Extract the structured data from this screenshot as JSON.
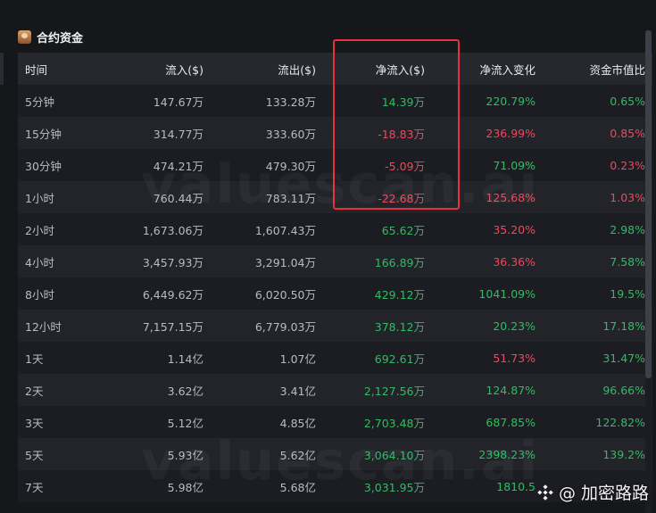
{
  "header": {
    "title": "合约资金"
  },
  "table": {
    "columns": [
      "时间",
      "流入($)",
      "流出($)",
      "净流入($)",
      "净流入变化",
      "资金市值比"
    ],
    "rows": [
      {
        "time": "5分钟",
        "inflow": "147.67万",
        "outflow": "133.28万",
        "net": "14.39万",
        "net_sign": "pos",
        "change": "220.79%",
        "change_sign": "pos",
        "ratio": "0.65%",
        "ratio_sign": "pos"
      },
      {
        "time": "15分钟",
        "inflow": "314.77万",
        "outflow": "333.60万",
        "net": "-18.83万",
        "net_sign": "neg",
        "change": "236.99%",
        "change_sign": "neg",
        "ratio": "0.85%",
        "ratio_sign": "neg"
      },
      {
        "time": "30分钟",
        "inflow": "474.21万",
        "outflow": "479.30万",
        "net": "-5.09万",
        "net_sign": "neg",
        "change": "71.09%",
        "change_sign": "pos",
        "ratio": "0.23%",
        "ratio_sign": "neg"
      },
      {
        "time": "1小时",
        "inflow": "760.44万",
        "outflow": "783.11万",
        "net": "-22.68万",
        "net_sign": "neg",
        "change": "125.68%",
        "change_sign": "neg",
        "ratio": "1.03%",
        "ratio_sign": "neg"
      },
      {
        "time": "2小时",
        "inflow": "1,673.06万",
        "outflow": "1,607.43万",
        "net": "65.62万",
        "net_sign": "pos",
        "change": "35.20%",
        "change_sign": "neg",
        "ratio": "2.98%",
        "ratio_sign": "pos"
      },
      {
        "time": "4小时",
        "inflow": "3,457.93万",
        "outflow": "3,291.04万",
        "net": "166.89万",
        "net_sign": "pos",
        "change": "36.36%",
        "change_sign": "neg",
        "ratio": "7.58%",
        "ratio_sign": "pos"
      },
      {
        "time": "8小时",
        "inflow": "6,449.62万",
        "outflow": "6,020.50万",
        "net": "429.12万",
        "net_sign": "pos",
        "change": "1041.09%",
        "change_sign": "pos",
        "ratio": "19.5%",
        "ratio_sign": "pos"
      },
      {
        "time": "12小时",
        "inflow": "7,157.15万",
        "outflow": "6,779.03万",
        "net": "378.12万",
        "net_sign": "pos",
        "change": "20.23%",
        "change_sign": "pos",
        "ratio": "17.18%",
        "ratio_sign": "pos"
      },
      {
        "time": "1天",
        "inflow": "1.14亿",
        "outflow": "1.07亿",
        "net": "692.61万",
        "net_sign": "pos",
        "change": "51.73%",
        "change_sign": "neg",
        "ratio": "31.47%",
        "ratio_sign": "pos"
      },
      {
        "time": "2天",
        "inflow": "3.62亿",
        "outflow": "3.41亿",
        "net": "2,127.56万",
        "net_sign": "pos",
        "change": "124.87%",
        "change_sign": "pos",
        "ratio": "96.66%",
        "ratio_sign": "pos"
      },
      {
        "time": "3天",
        "inflow": "5.12亿",
        "outflow": "4.85亿",
        "net": "2,703.48万",
        "net_sign": "pos",
        "change": "687.85%",
        "change_sign": "pos",
        "ratio": "122.82%",
        "ratio_sign": "pos"
      },
      {
        "time": "5天",
        "inflow": "5.93亿",
        "outflow": "5.62亿",
        "net": "3,064.10万",
        "net_sign": "pos",
        "change": "2398.23%",
        "change_sign": "pos",
        "ratio": "139.2%",
        "ratio_sign": "pos"
      },
      {
        "time": "7天",
        "inflow": "5.98亿",
        "outflow": "5.68亿",
        "net": "3,031.95万",
        "net_sign": "pos",
        "change": "1810.5",
        "change_sign": "pos",
        "ratio": "",
        "ratio_sign": "pos"
      }
    ]
  },
  "watermark": {
    "text": "valuescan.ai"
  },
  "signature": {
    "text": "@ 加密路路",
    "logo_icon": "binance-diamond-icon"
  },
  "colors": {
    "positive": "#2ebd62",
    "negative": "#f0475a",
    "highlight_border": "#e5303d"
  }
}
